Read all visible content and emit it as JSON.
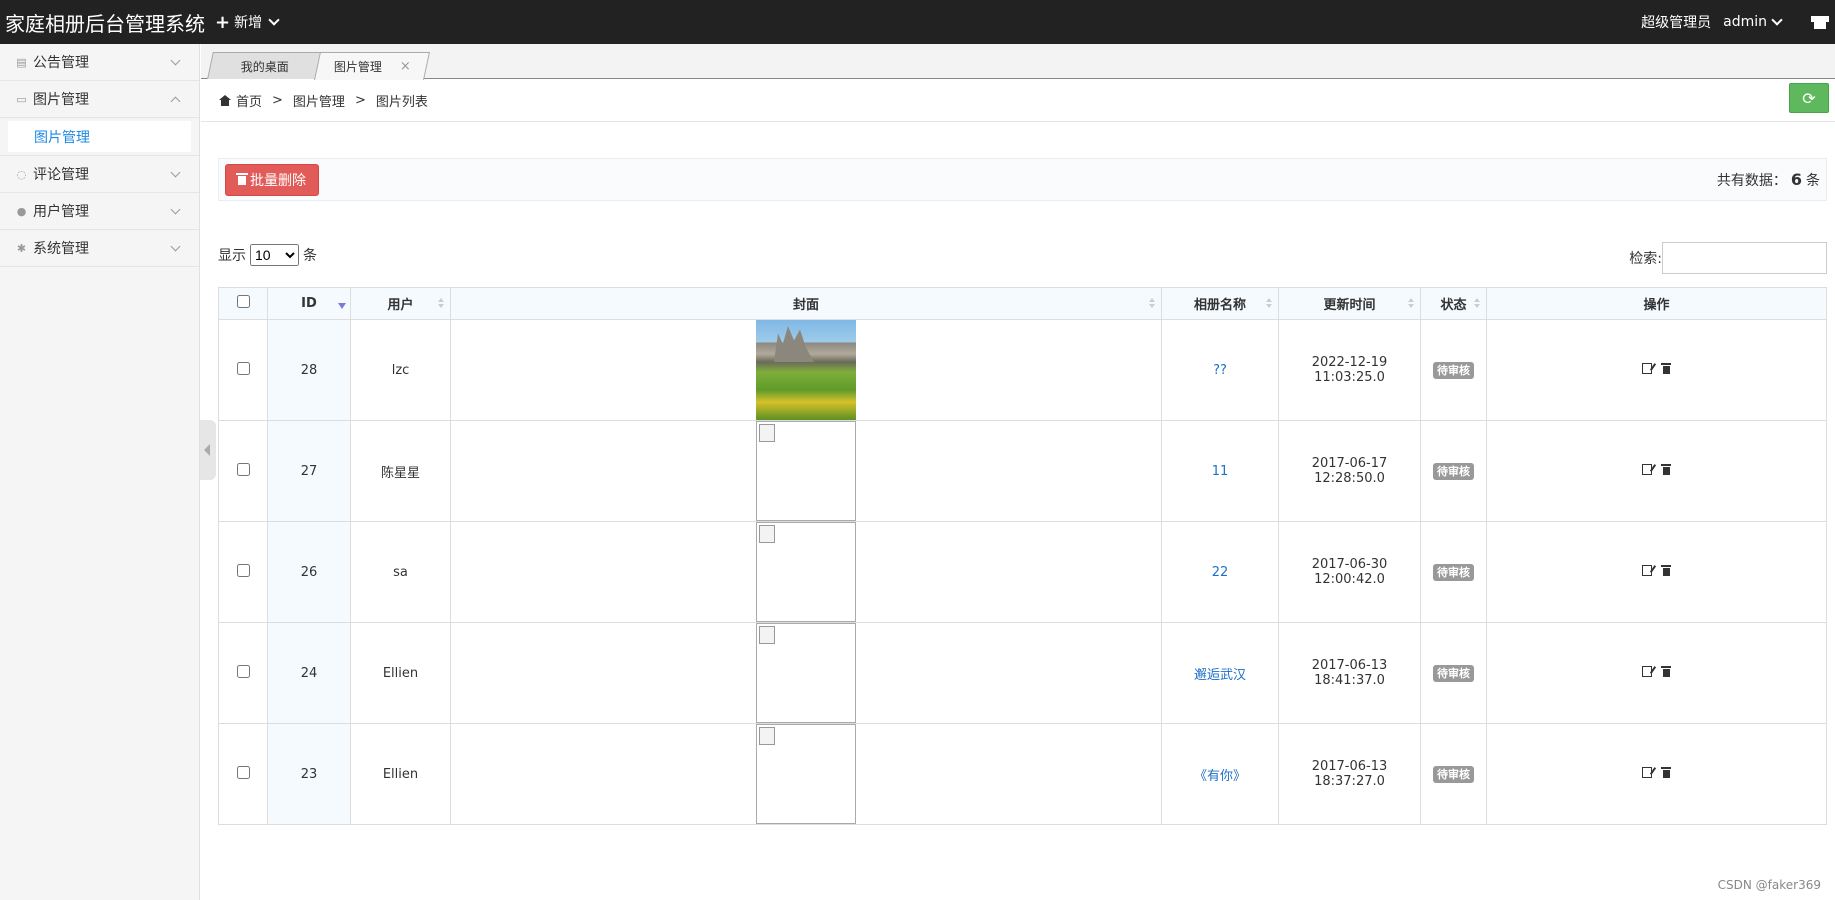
{
  "topbar": {
    "title": "家庭相册后台管理系统",
    "add_label": "新增",
    "role": "超级管理员",
    "user": "admin"
  },
  "sidebar": {
    "items": [
      {
        "label": "公告管理",
        "icon": "notice-icon",
        "expanded": false
      },
      {
        "label": "图片管理",
        "icon": "picture-icon",
        "expanded": true,
        "children": [
          "图片管理"
        ]
      },
      {
        "label": "评论管理",
        "icon": "comment-icon",
        "expanded": false
      },
      {
        "label": "用户管理",
        "icon": "user-icon",
        "expanded": false
      },
      {
        "label": "系统管理",
        "icon": "gear-icon",
        "expanded": false
      }
    ]
  },
  "tabs": [
    {
      "label": "我的桌面",
      "active": false
    },
    {
      "label": "图片管理",
      "active": true,
      "close": "×"
    }
  ],
  "breadcrumb": [
    "首页",
    "图片管理",
    "图片列表"
  ],
  "breadcrumb_sep": ">",
  "toolbar": {
    "batch_delete": "批量删除",
    "total_prefix": "共有数据：",
    "total_count": "6",
    "total_suffix": "条"
  },
  "length": {
    "prefix": "显示",
    "value": "10",
    "suffix": "条"
  },
  "search": {
    "label": "检索:",
    "value": ""
  },
  "table": {
    "columns": [
      "ID",
      "用户",
      "封面",
      "相册名称",
      "更新时间",
      "状态",
      "操作"
    ],
    "rows": [
      {
        "id": "28",
        "user": "lzc",
        "cover": "photo",
        "album": "??",
        "time": "2022-12-19 11:03:25.0",
        "status": "待审核"
      },
      {
        "id": "27",
        "user": "陈星星",
        "cover": "broken",
        "album": "11",
        "time": "2017-06-17 12:28:50.0",
        "status": "待审核"
      },
      {
        "id": "26",
        "user": "sa",
        "cover": "broken",
        "album": "22",
        "time": "2017-06-30 12:00:42.0",
        "status": "待审核"
      },
      {
        "id": "24",
        "user": "Ellien",
        "cover": "broken",
        "album": "邂逅武汉",
        "time": "2017-06-13 18:41:37.0",
        "status": "待审核"
      },
      {
        "id": "23",
        "user": "Ellien",
        "cover": "broken",
        "album": "《有你》",
        "time": "2017-06-13 18:37:27.0",
        "status": "待审核"
      }
    ]
  },
  "colors": {
    "topbar": "#222222",
    "danger": "#e15b59",
    "success": "#5eb95e",
    "link": "#1e6fc9"
  },
  "watermark": "CSDN @faker369"
}
